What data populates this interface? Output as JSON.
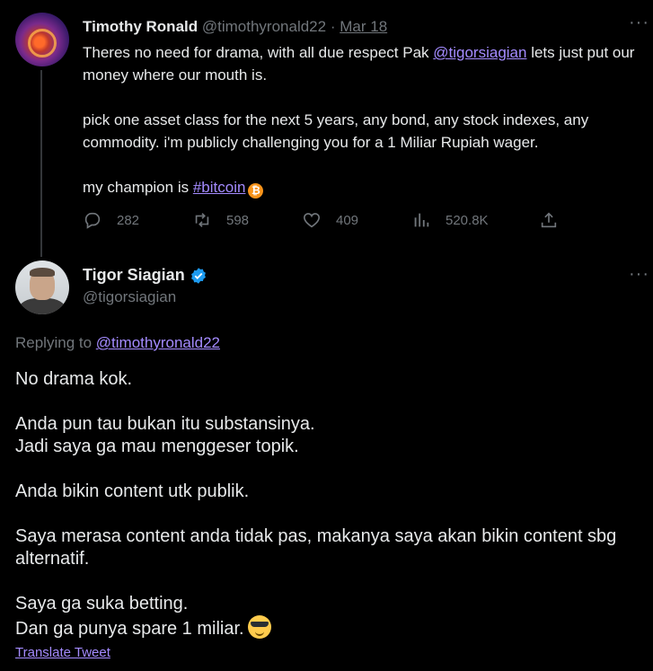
{
  "tweet1": {
    "name": "Timothy Ronald",
    "handle": "@timothyronald22",
    "separator": "·",
    "date": "Mar 18",
    "more": "···",
    "p1_pre": "Theres no need for drama, with all due respect Pak ",
    "p1_mention": "@tigorsiagian",
    "p1_post": " lets just put our money where our mouth is.",
    "p2": "pick one asset class for the next 5 years, any bond, any stock indexes, any commodity. i'm publicly challenging you for a 1 Miliar Rupiah wager.",
    "p3_pre": "my champion is ",
    "p3_hashtag": "#bitcoin",
    "btc_symbol": "₿",
    "replies": "282",
    "retweets": "598",
    "likes": "409",
    "views": "520.8K"
  },
  "tweet2": {
    "name": "Tigor Siagian",
    "handle": "@tigorsiagian",
    "more": "···",
    "replying_label": "Replying to ",
    "replying_mention": "@timothyronald22",
    "p1": "No drama kok.",
    "p2a": "Anda pun tau bukan itu substansinya.",
    "p2b": "Jadi saya ga mau menggeser topik.",
    "p3": "Anda bikin content utk publik.",
    "p4": "Saya merasa content anda tidak pas, makanya saya akan bikin content sbg alternatif.",
    "p5a": "Saya ga suka betting.",
    "p5b": "Dan ga punya spare 1 miliar.",
    "translate": "Translate Tweet"
  },
  "icons": {
    "reply": "reply-icon",
    "retweet": "retweet-icon",
    "like": "heart-icon",
    "views": "views-icon",
    "share": "share-icon",
    "verified": "verified-badge-icon",
    "emoji": "sunglasses-emoji-icon",
    "bitcoin": "bitcoin-icon"
  },
  "colors": {
    "background": "#000000",
    "text": "#e7e9ea",
    "muted": "#71767b",
    "link": "#a48bff",
    "verified": "#1d9bf0",
    "bitcoin": "#f7931a"
  }
}
